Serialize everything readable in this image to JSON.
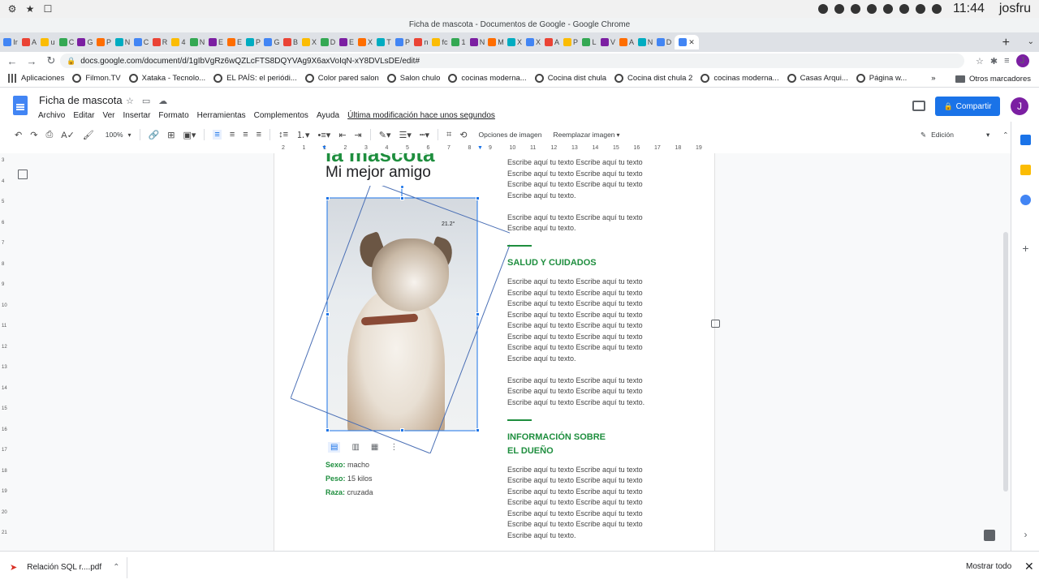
{
  "os": {
    "time": "11:44",
    "user": "josfru"
  },
  "window": {
    "title": "Ficha de mascota - Documentos de Google - Google Chrome"
  },
  "tabs": [
    "Ir",
    "A",
    "u",
    "C",
    "G",
    "P",
    "N",
    "C",
    "R",
    "4",
    "N",
    "E",
    "E",
    "P",
    "G",
    "B",
    "X",
    "D",
    "E",
    "X",
    "T",
    "P",
    "n",
    "fc",
    "1",
    "N",
    "M",
    "X",
    "X",
    "A",
    "P",
    "L",
    "V",
    "A",
    "N",
    "D"
  ],
  "address": {
    "url": "docs.google.com/document/d/1gIbVgRz6wQZLcFTS8DQYVAg9X6axVoIqN-xY8DVLsDE/edit#"
  },
  "bookmarks": [
    "Aplicaciones",
    "Filmon.TV",
    "Xataka - Tecnolo...",
    "EL PAÍS: el periódi...",
    "Color pared salon",
    "Salon chulo",
    "cocinas moderna...",
    "Cocina dist chula",
    "Cocina dist chula 2",
    "cocinas moderna...",
    "Casas Arqui...",
    "Página w..."
  ],
  "bookmarks_other": "Otros marcadores",
  "docs": {
    "title": "Ficha de mascota",
    "menu": [
      "Archivo",
      "Editar",
      "Ver",
      "Insertar",
      "Formato",
      "Herramientas",
      "Complementos",
      "Ayuda"
    ],
    "last_edit": "Última modificación hace unos segundos",
    "share": "Compartir",
    "account_initial": "J"
  },
  "toolbar": {
    "zoom": "100%",
    "image_options": "Opciones de imagen",
    "replace_image": "Reemplazar imagen",
    "mode": "Edición"
  },
  "ruler_ticks": [
    "2",
    "1",
    "1",
    "2",
    "3",
    "4",
    "5",
    "6",
    "7",
    "8",
    "9",
    "10",
    "11",
    "12",
    "13",
    "14",
    "15",
    "16",
    "17",
    "18",
    "19"
  ],
  "vruler_ticks": [
    "3",
    "4",
    "5",
    "6",
    "7",
    "8",
    "9",
    "10",
    "11",
    "12",
    "13",
    "14",
    "15",
    "16",
    "17",
    "18",
    "19",
    "20",
    "21"
  ],
  "pet": {
    "heading": "la mascota",
    "subtitle": "Mi mejor amigo",
    "rotation_label": "21.2°",
    "details": [
      {
        "label": "Sexo:",
        "value": "macho"
      },
      {
        "label": "Peso:",
        "value": "15 kilos"
      },
      {
        "label": "Raza:",
        "value": "cruzada"
      }
    ]
  },
  "right_column": {
    "p1": [
      "Escribe aquí tu texto Escribe aquí tu texto",
      "Escribe aquí tu texto Escribe aquí tu texto",
      "Escribe aquí tu texto Escribe aquí tu texto",
      "Escribe aquí tu texto."
    ],
    "p2": [
      "Escribe aquí tu texto Escribe aquí tu texto",
      "Escribe aquí tu texto."
    ],
    "sec1_title": "SALUD Y CUIDADOS",
    "sec1_p1": [
      "Escribe aquí tu texto Escribe aquí tu texto",
      "Escribe aquí tu texto Escribe aquí tu texto",
      "Escribe aquí tu texto Escribe aquí tu texto",
      "Escribe aquí tu texto Escribe aquí tu texto",
      "Escribe aquí tu texto Escribe aquí tu texto",
      "Escribe aquí tu texto Escribe aquí tu texto",
      "Escribe aquí tu texto Escribe aquí tu texto",
      "Escribe aquí tu texto."
    ],
    "sec1_p2": [
      "Escribe aquí tu texto Escribe aquí tu texto",
      "Escribe aquí tu texto Escribe aquí tu texto",
      "Escribe aquí tu texto Escribe aquí tu texto."
    ],
    "sec2_title_1": "INFORMACIÓN SOBRE",
    "sec2_title_2": "EL DUEÑO",
    "sec2_p1": [
      "Escribe aquí tu texto Escribe aquí tu texto",
      "Escribe aquí tu texto Escribe aquí tu texto",
      "Escribe aquí tu texto Escribe aquí tu texto",
      "Escribe aquí tu texto Escribe aquí tu texto",
      "Escribe aquí tu texto Escribe aquí tu texto",
      "Escribe aquí tu texto Escribe aquí tu texto",
      "Escribe aquí tu texto."
    ]
  },
  "downloads": {
    "file": "Relación SQL r....pdf",
    "show_all": "Mostrar todo"
  },
  "colors": {
    "accent": "#1a73e8",
    "green": "#1e8e3e"
  }
}
